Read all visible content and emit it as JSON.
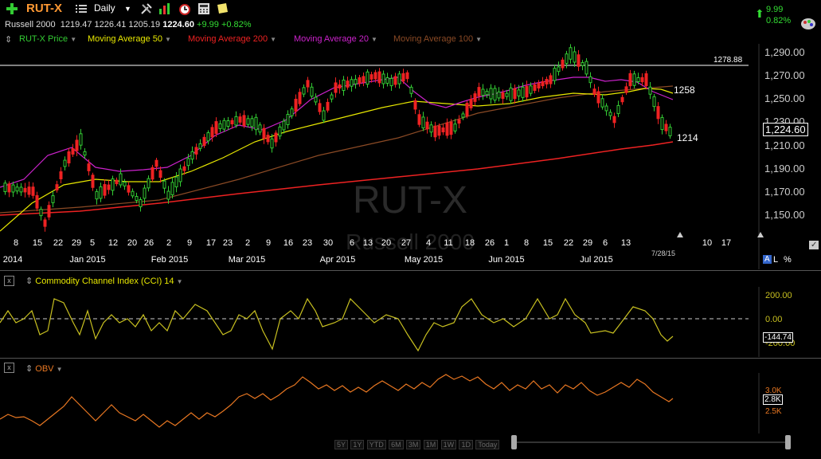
{
  "toolbar": {
    "symbol": "RUT-X",
    "interval": "Daily",
    "change_value": "9.99",
    "change_pct": "0.82%"
  },
  "quote": {
    "name": "Russell 2000",
    "open": "1219.47",
    "high": "1226.41",
    "low": "1205.19",
    "last": "1224.60",
    "change": "+9.99",
    "change_pct": "+0.82%"
  },
  "legend": [
    {
      "label": "RUT-X Price",
      "color": "#33cc33"
    },
    {
      "label": "Moving Average 50",
      "color": "#e8e800"
    },
    {
      "label": "Moving Average 200",
      "color": "#ee2222"
    },
    {
      "label": "Moving Average 20",
      "color": "#cc22cc"
    },
    {
      "label": "Moving Average 100",
      "color": "#8b4a25"
    }
  ],
  "price_axis": [
    "1,290.00",
    "1,270.00",
    "1,250.00",
    "1,230.00",
    "1,210.00",
    "1,190.00",
    "1,170.00",
    "1,150.00"
  ],
  "current_price_tag": "1,224.60",
  "annotations": {
    "resistance": "1278.88",
    "ma_label_1": "1258",
    "ma_label_2": "1214",
    "date_marker": "7/28/15"
  },
  "watermark": {
    "symbol": "RUT-X",
    "name": "Russell 2000"
  },
  "x_day_labels": [
    "8",
    "15",
    "22",
    "29",
    "5",
    "12",
    "20",
    "26",
    "2",
    "9",
    "17",
    "23",
    "2",
    "9",
    "16",
    "23",
    "30",
    "6",
    "13",
    "20",
    "27",
    "4",
    "11",
    "18",
    "26",
    "1",
    "8",
    "15",
    "22",
    "29",
    "6",
    "13",
    "10",
    "17"
  ],
  "x_month_labels": [
    "2014",
    "Jan 2015",
    "Feb 2015",
    "Mar 2015",
    "Apr 2015",
    "May 2015",
    "Jun 2015",
    "Jul 2015"
  ],
  "top_right_tools": {
    "a": "A",
    "l": "L",
    "pct": "%",
    "gear": "✓"
  },
  "cci": {
    "title": "Commodity Channel Index (CCI) 14",
    "axis": [
      "200.00",
      "0.00",
      "-200.00"
    ],
    "current": "-144.74"
  },
  "obv": {
    "title": "OBV",
    "axis": [
      "3.0K",
      "2.5K"
    ],
    "current": "2.8K"
  },
  "range_buttons": [
    "5Y",
    "1Y",
    "YTD",
    "6M",
    "3M",
    "1M",
    "1W",
    "1D",
    "Today"
  ]
}
